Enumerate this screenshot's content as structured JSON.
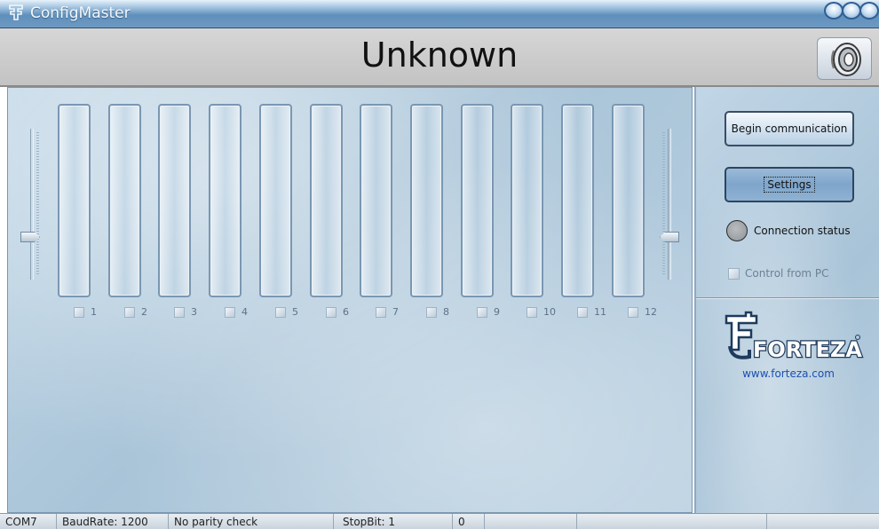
{
  "window": {
    "title": "ConfigMaster"
  },
  "header": {
    "title": "Unknown",
    "speaker_icon": "speaker-icon"
  },
  "channels": [
    {
      "label": "1"
    },
    {
      "label": "2"
    },
    {
      "label": "3"
    },
    {
      "label": "4"
    },
    {
      "label": "5"
    },
    {
      "label": "6"
    },
    {
      "label": "7"
    },
    {
      "label": "8"
    },
    {
      "label": "9"
    },
    {
      "label": "10"
    },
    {
      "label": "11"
    },
    {
      "label": "12"
    }
  ],
  "panel": {
    "begin_label": "Begin communication",
    "settings_label": "Settings",
    "connection_label": "Connection status",
    "control_pc_label": "Control from PC",
    "logo_text": "FORTEZA",
    "logo_url": "www.forteza.com"
  },
  "statusbar": {
    "port": "COM7",
    "baud": "BaudRate: 1200",
    "parity": "No parity check",
    "stopbit": "StopBit: 1",
    "count": "0"
  },
  "colors": {
    "accent": "#1b4fb0",
    "panel": "#b3cbdd",
    "header": "#c9c9c9"
  }
}
